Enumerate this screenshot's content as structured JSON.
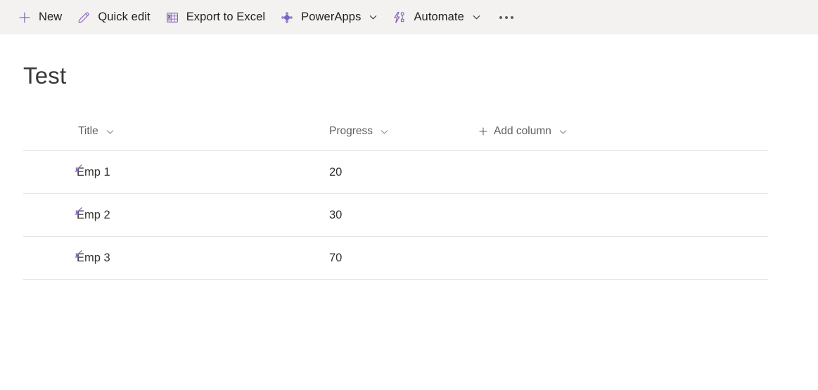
{
  "command_bar": {
    "background": "#f3f2f1",
    "accent": "#8764b8",
    "items": [
      {
        "id": "new",
        "label": "New",
        "icon": "plus-icon",
        "has_chevron": false
      },
      {
        "id": "quick-edit",
        "label": "Quick edit",
        "icon": "pencil-icon",
        "has_chevron": false
      },
      {
        "id": "export-to-excel",
        "label": "Export to Excel",
        "icon": "excel-grid-icon",
        "has_chevron": false
      },
      {
        "id": "powerapps",
        "label": "PowerApps",
        "icon": "powerapps-icon",
        "has_chevron": true
      },
      {
        "id": "automate",
        "label": "Automate",
        "icon": "power-automate-icon",
        "has_chevron": true
      }
    ],
    "overflow_label": "More options"
  },
  "page": {
    "title": "Test"
  },
  "list": {
    "columns": [
      {
        "id": "title",
        "label": "Title",
        "has_chevron": true,
        "has_plus": false
      },
      {
        "id": "progress",
        "label": "Progress",
        "has_chevron": true,
        "has_plus": false
      },
      {
        "id": "add-column",
        "label": "Add column",
        "has_chevron": true,
        "has_plus": true
      }
    ],
    "rows": [
      {
        "title": "Emp 1",
        "progress": "20"
      },
      {
        "title": "Emp 2",
        "progress": "30"
      },
      {
        "title": "Emp 3",
        "progress": "70"
      }
    ]
  }
}
